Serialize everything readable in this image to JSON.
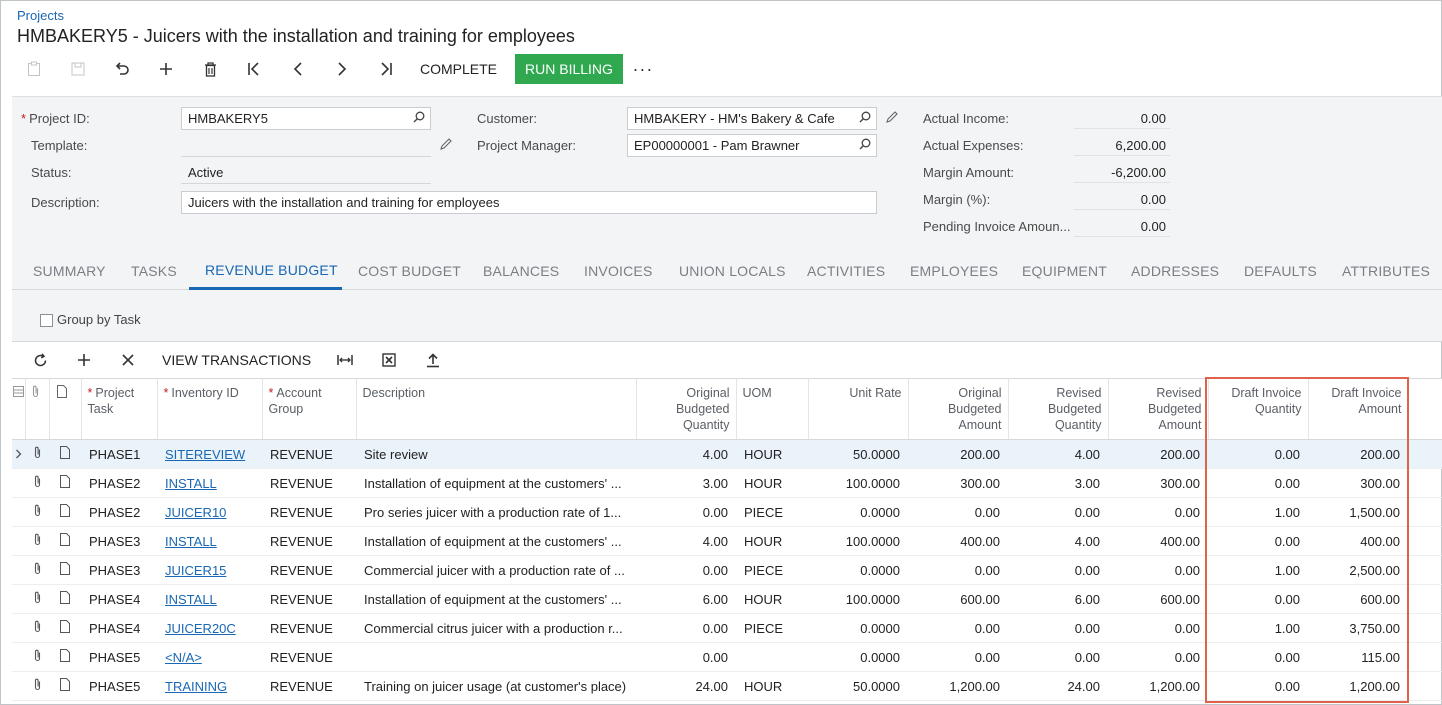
{
  "breadcrumb": "Projects",
  "title": "HMBAKERY5 - Juicers with the installation and training for employees",
  "toolbar": {
    "icons": [
      "clipboard-icon",
      "save-icon",
      "undo-icon",
      "add-icon",
      "delete-icon",
      "first-icon",
      "prev-icon",
      "next-icon",
      "last-icon"
    ],
    "complete_label": "COMPLETE",
    "run_billing_label": "RUN BILLING",
    "more_label": "···"
  },
  "form": {
    "project_id_label": "Project ID:",
    "project_id_value": "HMBAKERY5",
    "template_label": "Template:",
    "template_value": "",
    "status_label": "Status:",
    "status_value": "Active",
    "description_label": "Description:",
    "description_value": "Juicers with the installation and training for employees",
    "customer_label": "Customer:",
    "customer_value": "HMBAKERY - HM's Bakery & Cafe",
    "manager_label": "Project Manager:",
    "manager_value": "EP00000001 - Pam Brawner"
  },
  "summary": {
    "actual_income_label": "Actual Income:",
    "actual_income": "0.00",
    "actual_expenses_label": "Actual Expenses:",
    "actual_expenses": "6,200.00",
    "margin_amount_label": "Margin Amount:",
    "margin_amount": "-6,200.00",
    "margin_pct_label": "Margin (%):",
    "margin_pct": "0.00",
    "pending_invoice_label": "Pending Invoice Amoun...",
    "pending_invoice": "0.00"
  },
  "tabs": [
    "SUMMARY",
    "TASKS",
    "REVENUE BUDGET",
    "COST BUDGET",
    "BALANCES",
    "INVOICES",
    "UNION LOCALS",
    "ACTIVITIES",
    "EMPLOYEES",
    "EQUIPMENT",
    "ADDRESSES",
    "DEFAULTS",
    "ATTRIBUTES"
  ],
  "active_tab": "REVENUE BUDGET",
  "group_by_task_label": "Group by Task",
  "grid_toolbar": {
    "view_transactions_label": "VIEW TRANSACTIONS"
  },
  "columns": {
    "project_task": "Project Task",
    "inventory_id": "Inventory ID",
    "account_group": "Account Group",
    "description": "Description",
    "orig_qty": "Original Budgeted Quantity",
    "uom": "UOM",
    "unit_rate": "Unit Rate",
    "orig_amount": "Original Budgeted Amount",
    "rev_qty": "Revised Budgeted Quantity",
    "rev_amount": "Revised Budgeted Amount",
    "draft_qty": "Draft Invoice Quantity",
    "draft_amount": "Draft Invoice Amount"
  },
  "rows": [
    {
      "task": "PHASE1",
      "inventory": "SITEREVIEW",
      "account": "REVENUE",
      "description": "Site review",
      "orig_qty": "4.00",
      "uom": "HOUR",
      "unit_rate": "50.0000",
      "orig_amount": "200.00",
      "rev_qty": "4.00",
      "rev_amount": "200.00",
      "draft_qty": "0.00",
      "draft_amount": "200.00"
    },
    {
      "task": "PHASE2",
      "inventory": "INSTALL",
      "account": "REVENUE",
      "description": "Installation of equipment at the customers' ...",
      "orig_qty": "3.00",
      "uom": "HOUR",
      "unit_rate": "100.0000",
      "orig_amount": "300.00",
      "rev_qty": "3.00",
      "rev_amount": "300.00",
      "draft_qty": "0.00",
      "draft_amount": "300.00"
    },
    {
      "task": "PHASE2",
      "inventory": "JUICER10",
      "account": "REVENUE",
      "description": "Pro series juicer with a production rate of 1...",
      "orig_qty": "0.00",
      "uom": "PIECE",
      "unit_rate": "0.0000",
      "orig_amount": "0.00",
      "rev_qty": "0.00",
      "rev_amount": "0.00",
      "draft_qty": "1.00",
      "draft_amount": "1,500.00"
    },
    {
      "task": "PHASE3",
      "inventory": "INSTALL",
      "account": "REVENUE",
      "description": "Installation of equipment at the customers' ...",
      "orig_qty": "4.00",
      "uom": "HOUR",
      "unit_rate": "100.0000",
      "orig_amount": "400.00",
      "rev_qty": "4.00",
      "rev_amount": "400.00",
      "draft_qty": "0.00",
      "draft_amount": "400.00"
    },
    {
      "task": "PHASE3",
      "inventory": "JUICER15",
      "account": "REVENUE",
      "description": "Commercial juicer with a production rate of ...",
      "orig_qty": "0.00",
      "uom": "PIECE",
      "unit_rate": "0.0000",
      "orig_amount": "0.00",
      "rev_qty": "0.00",
      "rev_amount": "0.00",
      "draft_qty": "1.00",
      "draft_amount": "2,500.00"
    },
    {
      "task": "PHASE4",
      "inventory": "INSTALL",
      "account": "REVENUE",
      "description": "Installation of equipment at the customers' ...",
      "orig_qty": "6.00",
      "uom": "HOUR",
      "unit_rate": "100.0000",
      "orig_amount": "600.00",
      "rev_qty": "6.00",
      "rev_amount": "600.00",
      "draft_qty": "0.00",
      "draft_amount": "600.00"
    },
    {
      "task": "PHASE4",
      "inventory": "JUICER20C",
      "account": "REVENUE",
      "description": "Commercial citrus juicer with a production r...",
      "orig_qty": "0.00",
      "uom": "PIECE",
      "unit_rate": "0.0000",
      "orig_amount": "0.00",
      "rev_qty": "0.00",
      "rev_amount": "0.00",
      "draft_qty": "1.00",
      "draft_amount": "3,750.00"
    },
    {
      "task": "PHASE5",
      "inventory": "<N/A>",
      "account": "REVENUE",
      "description": "",
      "orig_qty": "0.00",
      "uom": "",
      "unit_rate": "0.0000",
      "orig_amount": "0.00",
      "rev_qty": "0.00",
      "rev_amount": "0.00",
      "draft_qty": "0.00",
      "draft_amount": "115.00"
    },
    {
      "task": "PHASE5",
      "inventory": "TRAINING",
      "account": "REVENUE",
      "description": "Training on juicer usage (at customer's place)",
      "orig_qty": "24.00",
      "uom": "HOUR",
      "unit_rate": "50.0000",
      "orig_amount": "1,200.00",
      "rev_qty": "24.00",
      "rev_amount": "1,200.00",
      "draft_qty": "0.00",
      "draft_amount": "1,200.00"
    }
  ],
  "colors": {
    "accent": "#1a67b3",
    "run_billing": "#2fa84f",
    "highlight_box": "#e0624a"
  }
}
